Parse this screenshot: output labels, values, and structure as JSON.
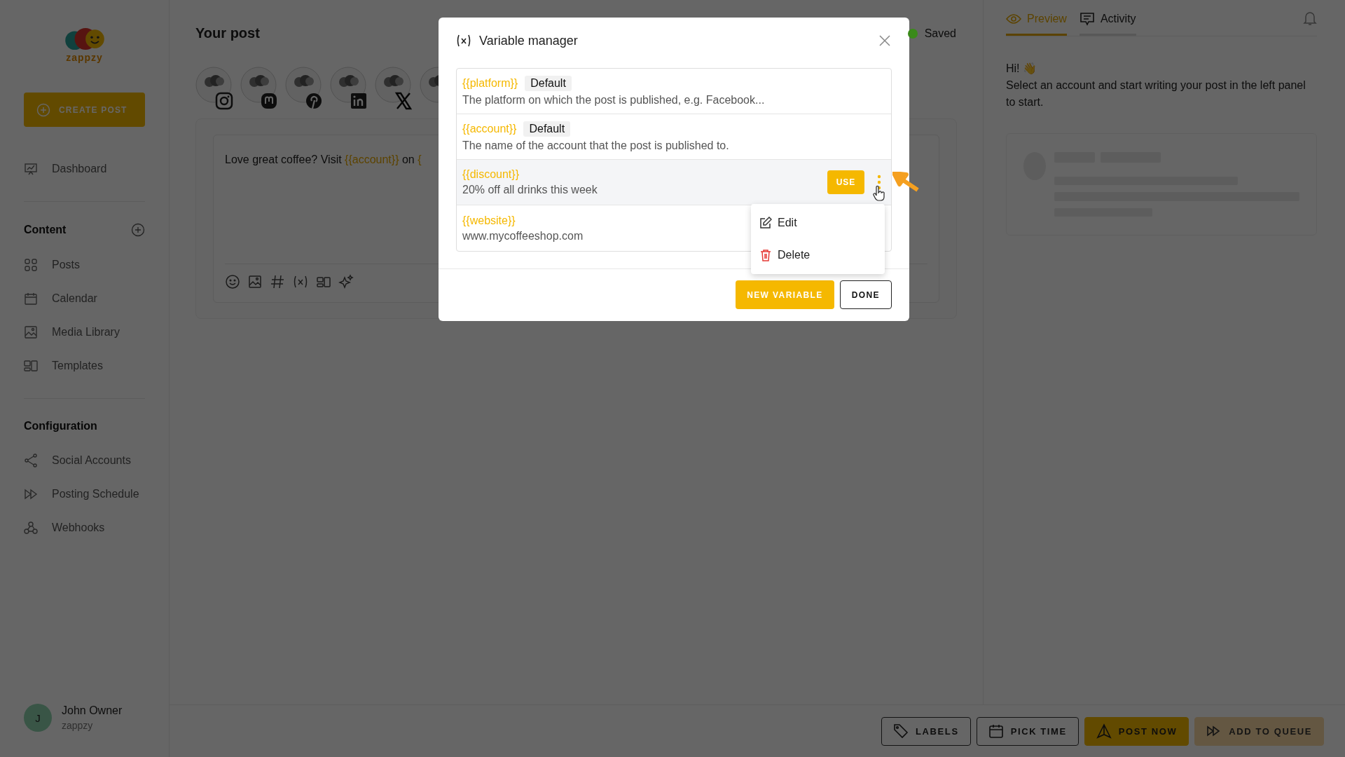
{
  "sidebar": {
    "logo_text": "zappzy",
    "create_button": "CREATE POST",
    "top_items": [
      {
        "label": "Dashboard"
      }
    ],
    "sections": [
      {
        "title": "Content",
        "add": true,
        "items": [
          {
            "label": "Posts"
          },
          {
            "label": "Calendar"
          },
          {
            "label": "Media Library"
          },
          {
            "label": "Templates"
          }
        ]
      },
      {
        "title": "Configuration",
        "add": false,
        "items": [
          {
            "label": "Social Accounts"
          },
          {
            "label": "Posting Schedule"
          },
          {
            "label": "Webhooks"
          }
        ]
      }
    ],
    "user": {
      "initial": "J",
      "name": "John Owner",
      "org": "zappzy"
    }
  },
  "post": {
    "title": "Your post",
    "status": {
      "label": "Saved",
      "color": "#3a8a1a"
    },
    "segments": [
      {
        "text": "Love great coffee? Visit ",
        "variable": false
      },
      {
        "text": "{{account}}",
        "variable": true
      },
      {
        "text": " on ",
        "variable": false
      },
      {
        "text": "{",
        "variable": true
      }
    ]
  },
  "modal": {
    "title": "Variable manager",
    "variables": [
      {
        "name": "{{platform}}",
        "badge": "Default",
        "description": "The platform on which the post is published, e.g. Facebook...",
        "hovered": false
      },
      {
        "name": "{{account}}",
        "badge": "Default",
        "description": "The name of the account that the post is published to.",
        "hovered": false
      },
      {
        "name": "{{discount}}",
        "description": "20% off all drinks this week",
        "hovered": true,
        "use_button": "USE"
      },
      {
        "name": "{{website}}",
        "description": "www.mycoffeeshop.com",
        "hovered": false
      }
    ],
    "menu": [
      {
        "label": "Edit",
        "kind": "edit"
      },
      {
        "label": "Delete",
        "kind": "delete"
      }
    ],
    "buttons": [
      {
        "label": "NEW VARIABLE",
        "kind": "primary"
      },
      {
        "label": "DONE",
        "kind": "outline"
      }
    ]
  },
  "preview": {
    "tabs": [
      {
        "label": "Preview",
        "selected": true
      },
      {
        "label": "Activity",
        "selected": false
      }
    ],
    "greeting": "Hi! 👋",
    "message": "Select an account and start writing your post in the left panel to start."
  },
  "actions": [
    {
      "label": "LABELS",
      "kind": "outline"
    },
    {
      "label": "PICK TIME",
      "kind": "outline"
    },
    {
      "label": "POST NOW",
      "kind": "primary"
    },
    {
      "label": "ADD TO QUEUE",
      "kind": "muted"
    }
  ]
}
